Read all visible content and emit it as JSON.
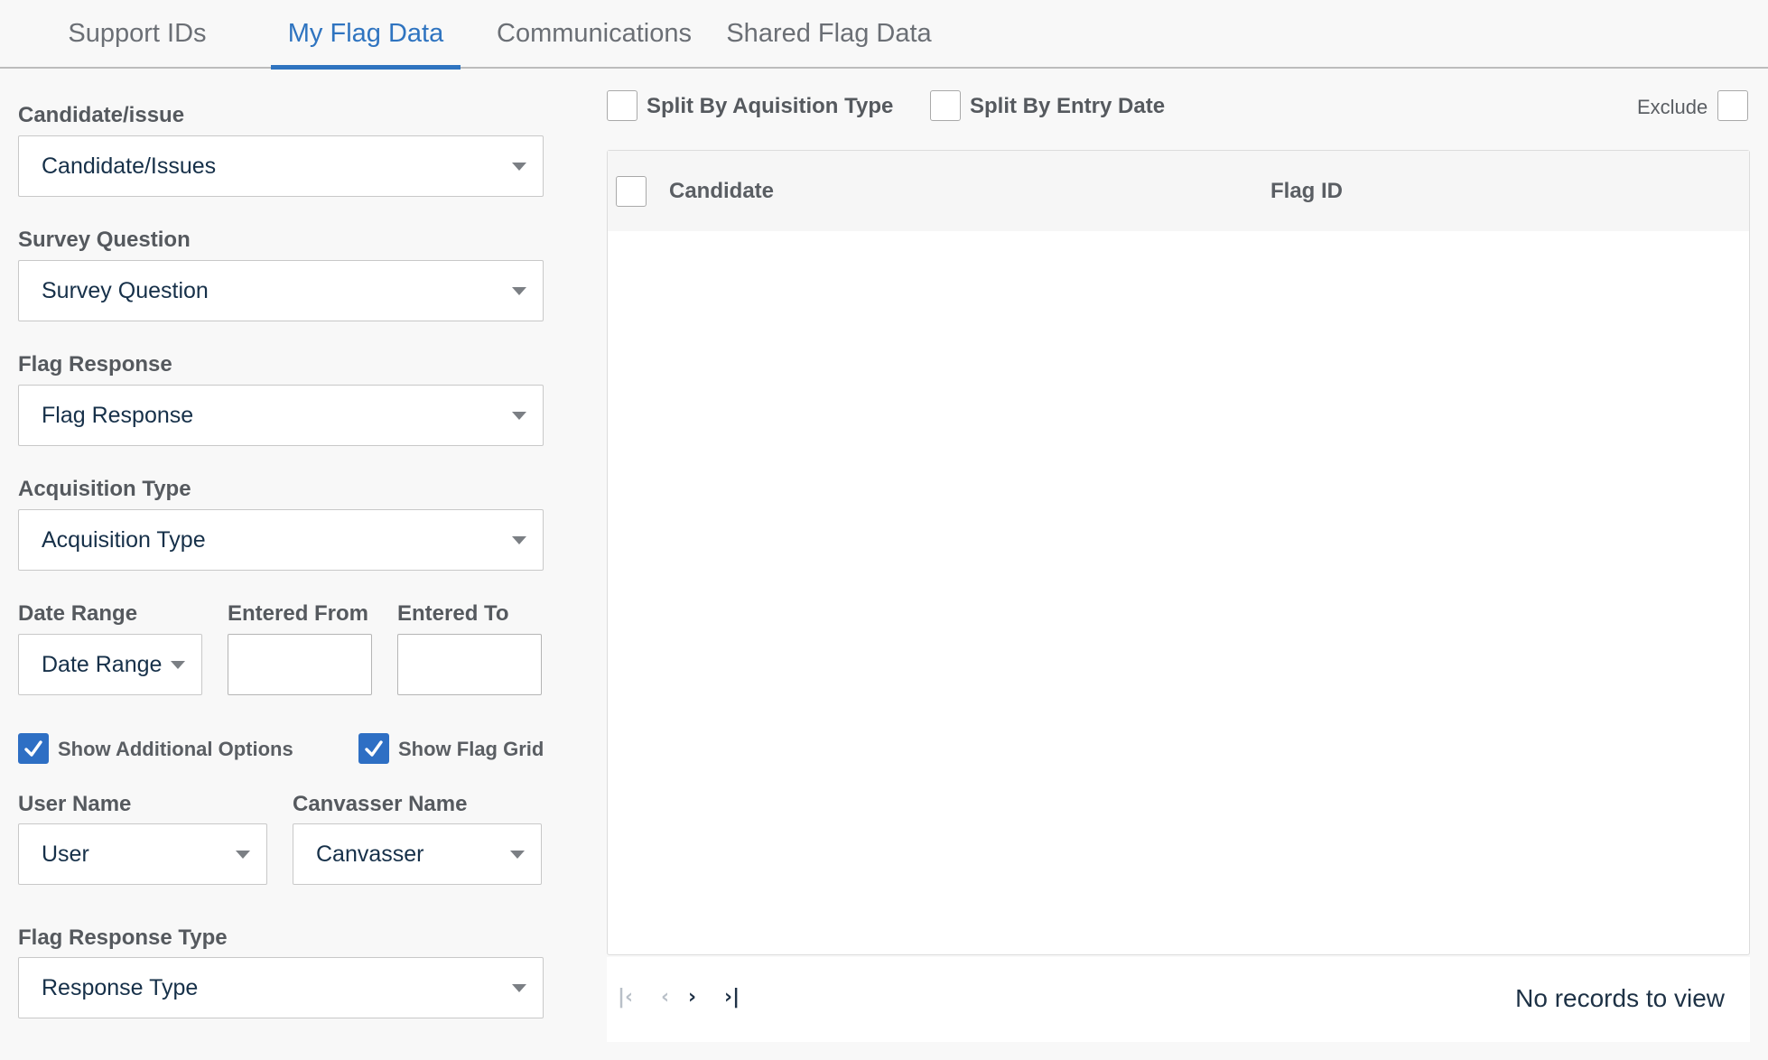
{
  "tabs": [
    {
      "label": "Support IDs",
      "active": false
    },
    {
      "label": "My Flag Data",
      "active": true
    },
    {
      "label": "Communications",
      "active": false
    },
    {
      "label": "Shared Flag Data",
      "active": false
    }
  ],
  "filters": {
    "candidate": {
      "label": "Candidate/issue",
      "value": "Candidate/Issues"
    },
    "survey_question": {
      "label": "Survey Question",
      "value": "Survey Question"
    },
    "flag_response": {
      "label": "Flag Response",
      "value": "Flag Response"
    },
    "acquisition_type": {
      "label": "Acquisition Type",
      "value": "Acquisition Type"
    },
    "date_range": {
      "label": "Date Range",
      "value": "Date Range"
    },
    "entered_from": {
      "label": "Entered From",
      "value": ""
    },
    "entered_to": {
      "label": "Entered To",
      "value": ""
    },
    "show_additional_options": {
      "label": "Show Additional Options",
      "checked": true
    },
    "show_flag_grid": {
      "label": "Show Flag Grid",
      "checked": true
    },
    "user_name": {
      "label": "User Name",
      "value": "User"
    },
    "canvasser_name": {
      "label": "Canvasser Name",
      "value": "Canvasser"
    },
    "flag_response_type": {
      "label": "Flag Response Type",
      "value": "Response Type"
    }
  },
  "options": {
    "split_by_acquisition": {
      "label": "Split By Aquisition Type",
      "checked": false
    },
    "split_by_entry_date": {
      "label": "Split By Entry Date",
      "checked": false
    },
    "exclude": {
      "label": "Exclude",
      "checked": false
    }
  },
  "grid": {
    "columns": [
      "Candidate",
      "Flag ID"
    ],
    "rows": [],
    "empty_message": "No records to view"
  },
  "pager": {
    "first_icon": "first-page-icon",
    "prev_icon": "prev-page-icon",
    "next_icon": "next-page-icon",
    "last_icon": "last-page-icon"
  },
  "colors": {
    "accent": "#2f74c0",
    "checkbox_checked": "#2e6fc4"
  }
}
